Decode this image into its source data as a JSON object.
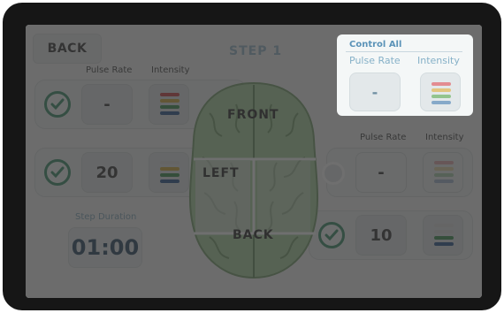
{
  "header": {
    "back_label": "BACK",
    "step_title": "STEP 1"
  },
  "columns": {
    "pulse_rate": "Pulse Rate",
    "intensity": "Intensity"
  },
  "regions": {
    "front": {
      "label": "FRONT",
      "pulse_rate": "-",
      "checked": true
    },
    "left": {
      "label": "LEFT",
      "pulse_rate": "20",
      "checked": true
    },
    "right": {
      "pulse_rate": "-",
      "checked": false
    },
    "back": {
      "label": "BACK",
      "pulse_rate": "10",
      "checked": true
    }
  },
  "step_duration": {
    "label": "Step Duration",
    "value": "01:00"
  },
  "control_all": {
    "title": "Control All",
    "pulse_rate_header": "Pulse Rate",
    "intensity_header": "Intensity",
    "pulse_rate": "-"
  },
  "colors": {
    "accent": "#5b93b8",
    "check": "#2f8a63",
    "brain": "#a6cf9c",
    "bar_red": "#c9363a",
    "bar_yellow": "#cfa72f",
    "bar_green": "#2f8a45",
    "bar_blue": "#1f4e8a"
  }
}
